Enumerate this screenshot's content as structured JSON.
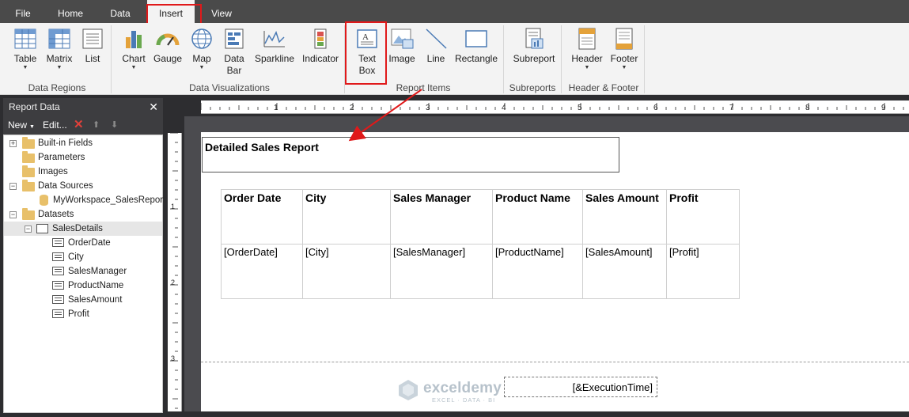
{
  "tabs": [
    {
      "label": "File"
    },
    {
      "label": "Home"
    },
    {
      "label": "Data"
    },
    {
      "label": "Insert",
      "active": true
    },
    {
      "label": "View"
    }
  ],
  "ribbon": {
    "groups": {
      "data_regions": "Data Regions",
      "data_visualizations": "Data Visualizations",
      "report_items": "Report Items",
      "subreports": "Subreports",
      "header_footer": "Header & Footer"
    },
    "buttons": {
      "table": "Table",
      "matrix": "Matrix",
      "list": "List",
      "chart": "Chart",
      "gauge": "Gauge",
      "map": "Map",
      "data_bar_1": "Data",
      "data_bar_2": "Bar",
      "sparkline": "Sparkline",
      "indicator": "Indicator",
      "text_box_1": "Text",
      "text_box_2": "Box",
      "image": "Image",
      "line": "Line",
      "rectangle": "Rectangle",
      "subreport": "Subreport",
      "header": "Header",
      "footer": "Footer"
    }
  },
  "report_data_panel": {
    "title": "Report Data",
    "toolbar": {
      "new": "New",
      "edit": "Edit..."
    },
    "tree": {
      "built_in_fields": "Built-in Fields",
      "parameters": "Parameters",
      "images": "Images",
      "data_sources": "Data Sources",
      "data_source_item": "MyWorkspace_SalesReport",
      "datasets": "Datasets",
      "dataset": "SalesDetails",
      "fields": [
        "OrderDate",
        "City",
        "SalesManager",
        "ProductName",
        "SalesAmount",
        "Profit"
      ]
    }
  },
  "ruler": {
    "top_numbers": [
      "1",
      "2",
      "3",
      "4",
      "5",
      "6",
      "7",
      "8",
      "9"
    ],
    "left_numbers": [
      "1",
      "2",
      "3"
    ]
  },
  "report": {
    "title": "Detailed Sales Report",
    "table": {
      "headers": [
        "Order Date",
        "City",
        "Sales Manager",
        "Product Name",
        "Sales Amount",
        "Profit"
      ],
      "detail": [
        "[OrderDate]",
        "[City]",
        "[SalesManager]",
        "[ProductName]",
        "[SalesAmount]",
        "[Profit]"
      ]
    },
    "footer_expression": "[&ExecutionTime]"
  },
  "watermark": {
    "name": "exceldemy",
    "tagline": "EXCEL · DATA · BI"
  },
  "colors": {
    "highlight": "#e0191a",
    "accent": "#2b79c2"
  }
}
